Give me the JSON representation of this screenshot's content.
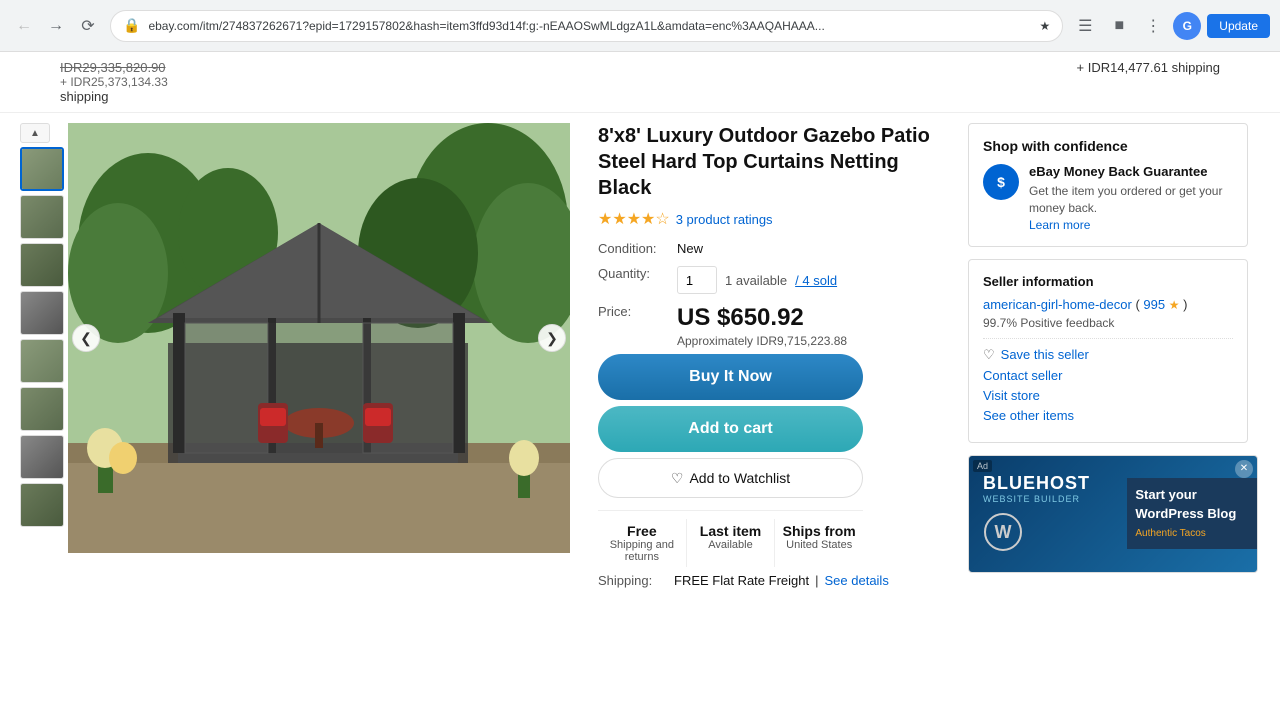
{
  "browser": {
    "url": "ebay.com/itm/274837262671?epid=1729157802&hash=item3ffd93d14f:g:-nEAAOSwMLdgzA1L&amdata=enc%3AAQAHAAA...",
    "update_label": "Update"
  },
  "promo": {
    "price_strikethrough": "IDR29,335,820.90",
    "price_plus": "+ IDR25,373,134.33",
    "shipping_label": "shipping",
    "right_price": "+ IDR14,477.61 shipping"
  },
  "product": {
    "title": "8'x8' Luxury Outdoor Gazebo Patio Steel Hard Top Curtains Netting Black",
    "stars": "★★★★☆",
    "ratings_count": "3 product ratings",
    "condition_label": "Condition:",
    "condition_value": "New",
    "quantity_label": "Quantity:",
    "quantity_value": "1",
    "quantity_available": "1 available",
    "quantity_sold": "/ 4 sold",
    "price_label": "Price:",
    "price_main": "US $650.92",
    "price_approx": "Approximately IDR9,715,223.88",
    "btn_buy_now": "Buy It Now",
    "btn_add_cart": "Add to cart",
    "btn_watchlist": "Add to Watchlist",
    "shipping_col1_title": "Free",
    "shipping_col1_sub": "Shipping and returns",
    "shipping_col2_title": "Last item",
    "shipping_col2_sub": "Available",
    "shipping_col3_title": "Ships from",
    "shipping_col3_sub": "United States",
    "shipping_label": "Shipping:",
    "shipping_value": "FREE Flat Rate Freight",
    "shipping_see_details": "See details"
  },
  "confidence": {
    "title": "Shop with confidence",
    "guarantee_title": "eBay Money Back Guarantee",
    "guarantee_desc": "Get the item you ordered or get your money back.",
    "learn_more": "Learn more"
  },
  "seller": {
    "title": "Seller information",
    "name": "american-girl-home-decor",
    "rating": "995",
    "star": "★",
    "feedback": "99.7% Positive feedback",
    "save_label": "Save this seller",
    "contact_label": "Contact seller",
    "visit_label": "Visit store",
    "other_label": "See other items"
  },
  "ad": {
    "badge": "Ad",
    "logo": "BLUEHOST",
    "logo_sub": "WEBSITE BUILDER",
    "headline": "Start your WordPress Blog",
    "taco": "Authentic Tacos"
  },
  "thumbnails": [
    {
      "id": "thumb-1",
      "active": true
    },
    {
      "id": "thumb-2",
      "active": false
    },
    {
      "id": "thumb-3",
      "active": false
    },
    {
      "id": "thumb-4",
      "active": false
    },
    {
      "id": "thumb-5",
      "active": false
    },
    {
      "id": "thumb-6",
      "active": false
    },
    {
      "id": "thumb-7",
      "active": false
    },
    {
      "id": "thumb-8",
      "active": false
    }
  ]
}
